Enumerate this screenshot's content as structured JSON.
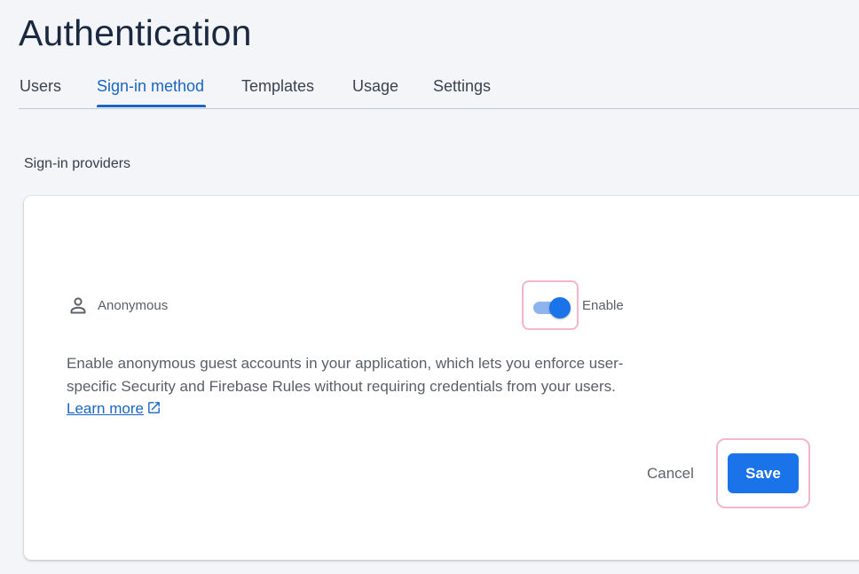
{
  "page": {
    "title": "Authentication"
  },
  "tabs": [
    {
      "label": "Users",
      "active": false
    },
    {
      "label": "Sign-in method",
      "active": true
    },
    {
      "label": "Templates",
      "active": false
    },
    {
      "label": "Usage",
      "active": false
    },
    {
      "label": "Settings",
      "active": false
    }
  ],
  "section": {
    "label": "Sign-in providers"
  },
  "provider": {
    "icon": "person-icon",
    "name": "Anonymous",
    "toggle_on": true,
    "toggle_label": "Enable",
    "description": "Enable anonymous guest accounts in your application, which lets you enforce user-specific Security and Firebase Rules without requiring credentials from your users.",
    "learn_more_label": "Learn more",
    "learn_more_icon": "external-link-icon"
  },
  "actions": {
    "cancel_label": "Cancel",
    "save_label": "Save"
  },
  "colors": {
    "accent": "#1a73e8",
    "highlight": "#f4b6cb",
    "title": "#1a2940"
  }
}
